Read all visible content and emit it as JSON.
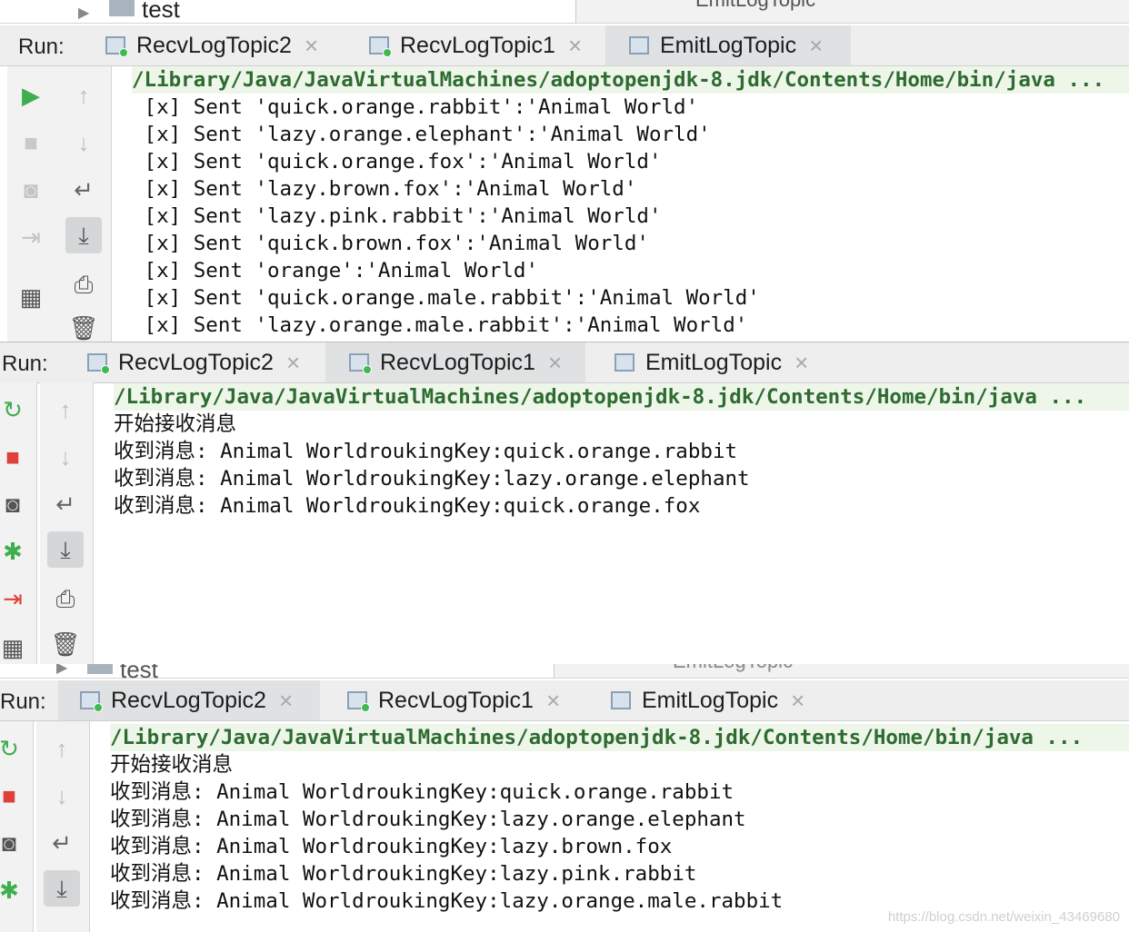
{
  "colors": {
    "run_green": "#3fae4f",
    "stop_red": "#e0403a",
    "path_text": "#2d6b30",
    "path_bg": "#eef6ea"
  },
  "icons": [
    "run-icon",
    "rerun-icon",
    "stop-icon",
    "camera-icon",
    "debug-icon",
    "login-icon",
    "layout-icon",
    "up-arrow-icon",
    "down-arrow-icon",
    "soft-wrap-icon",
    "scroll-to-end-icon",
    "print-icon",
    "trash-icon"
  ],
  "panel1": {
    "tree": {
      "folder_label": "test",
      "right_label": "EmitLogTopic"
    },
    "run_label": "Run:",
    "tabs": [
      {
        "label": "RecvLogTopic2",
        "close": "×"
      },
      {
        "label": "RecvLogTopic1",
        "close": "×"
      },
      {
        "label": "EmitLogTopic",
        "close": "×"
      }
    ],
    "console": [
      "/Library/Java/JavaVirtualMachines/adoptopenjdk-8.jdk/Contents/Home/bin/java ...",
      " [x] Sent 'quick.orange.rabbit':'Animal World'",
      " [x] Sent 'lazy.orange.elephant':'Animal World'",
      " [x] Sent 'quick.orange.fox':'Animal World'",
      " [x] Sent 'lazy.brown.fox':'Animal World'",
      " [x] Sent 'lazy.pink.rabbit':'Animal World'",
      " [x] Sent 'quick.brown.fox':'Animal World'",
      " [x] Sent 'orange':'Animal World'",
      " [x] Sent 'quick.orange.male.rabbit':'Animal World'",
      " [x] Sent 'lazy.orange.male.rabbit':'Animal World'"
    ]
  },
  "panel2": {
    "run_label": "Run:",
    "tabs": [
      {
        "label": "RecvLogTopic2",
        "close": "×"
      },
      {
        "label": "RecvLogTopic1",
        "close": "×"
      },
      {
        "label": "EmitLogTopic",
        "close": "×"
      }
    ],
    "console": [
      "/Library/Java/JavaVirtualMachines/adoptopenjdk-8.jdk/Contents/Home/bin/java ...",
      "开始接收消息",
      "收到消息: Animal WorldroukingKey:quick.orange.rabbit",
      "收到消息: Animal WorldroukingKey:lazy.orange.elephant",
      "收到消息: Animal WorldroukingKey:quick.orange.fox"
    ]
  },
  "panel3": {
    "tree": {
      "folder_label": "test",
      "right_label": "EmitLogTopic"
    },
    "run_label": "Run:",
    "tabs": [
      {
        "label": "RecvLogTopic2",
        "close": "×"
      },
      {
        "label": "RecvLogTopic1",
        "close": "×"
      },
      {
        "label": "EmitLogTopic",
        "close": "×"
      }
    ],
    "console": [
      "/Library/Java/JavaVirtualMachines/adoptopenjdk-8.jdk/Contents/Home/bin/java ...",
      "开始接收消息",
      "收到消息: Animal WorldroukingKey:quick.orange.rabbit",
      "收到消息: Animal WorldroukingKey:lazy.orange.elephant",
      "收到消息: Animal WorldroukingKey:lazy.brown.fox",
      "收到消息: Animal WorldroukingKey:lazy.pink.rabbit",
      "收到消息: Animal WorldroukingKey:lazy.orange.male.rabbit"
    ]
  },
  "watermark": "https://blog.csdn.net/weixin_43469680"
}
